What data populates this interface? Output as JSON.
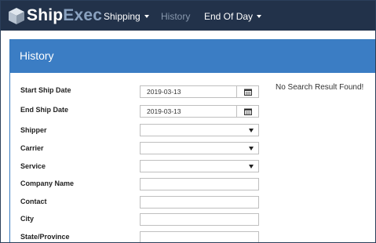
{
  "app": {
    "logo_part1": "Ship",
    "logo_part2": "Exec"
  },
  "nav": {
    "items": [
      {
        "label": "Shipping",
        "has_dropdown": true,
        "active": true
      },
      {
        "label": "History",
        "has_dropdown": false,
        "active": false
      },
      {
        "label": "End Of Day",
        "has_dropdown": true,
        "active": true
      }
    ]
  },
  "panel": {
    "title": "History",
    "no_result_text": "No Search Result Found!"
  },
  "form": {
    "start_ship_date": {
      "label": "Start Ship Date",
      "value": "2019-03-13",
      "icon": "calendar-icon"
    },
    "end_ship_date": {
      "label": "End Ship Date",
      "value": "2019-03-13",
      "icon": "calendar-icon"
    },
    "shipper": {
      "label": "Shipper",
      "value": ""
    },
    "carrier": {
      "label": "Carrier",
      "value": ""
    },
    "service": {
      "label": "Service",
      "value": ""
    },
    "company_name": {
      "label": "Company Name",
      "value": ""
    },
    "contact": {
      "label": "Contact",
      "value": ""
    },
    "city": {
      "label": "City",
      "value": ""
    },
    "state_province": {
      "label": "State/Province",
      "value": ""
    }
  },
  "colors": {
    "navbar_bg": "#22324a",
    "panel_heading_bg": "#3b7dc4",
    "logo_accent": "#8aa2c0",
    "nav_muted": "#8898ad"
  }
}
